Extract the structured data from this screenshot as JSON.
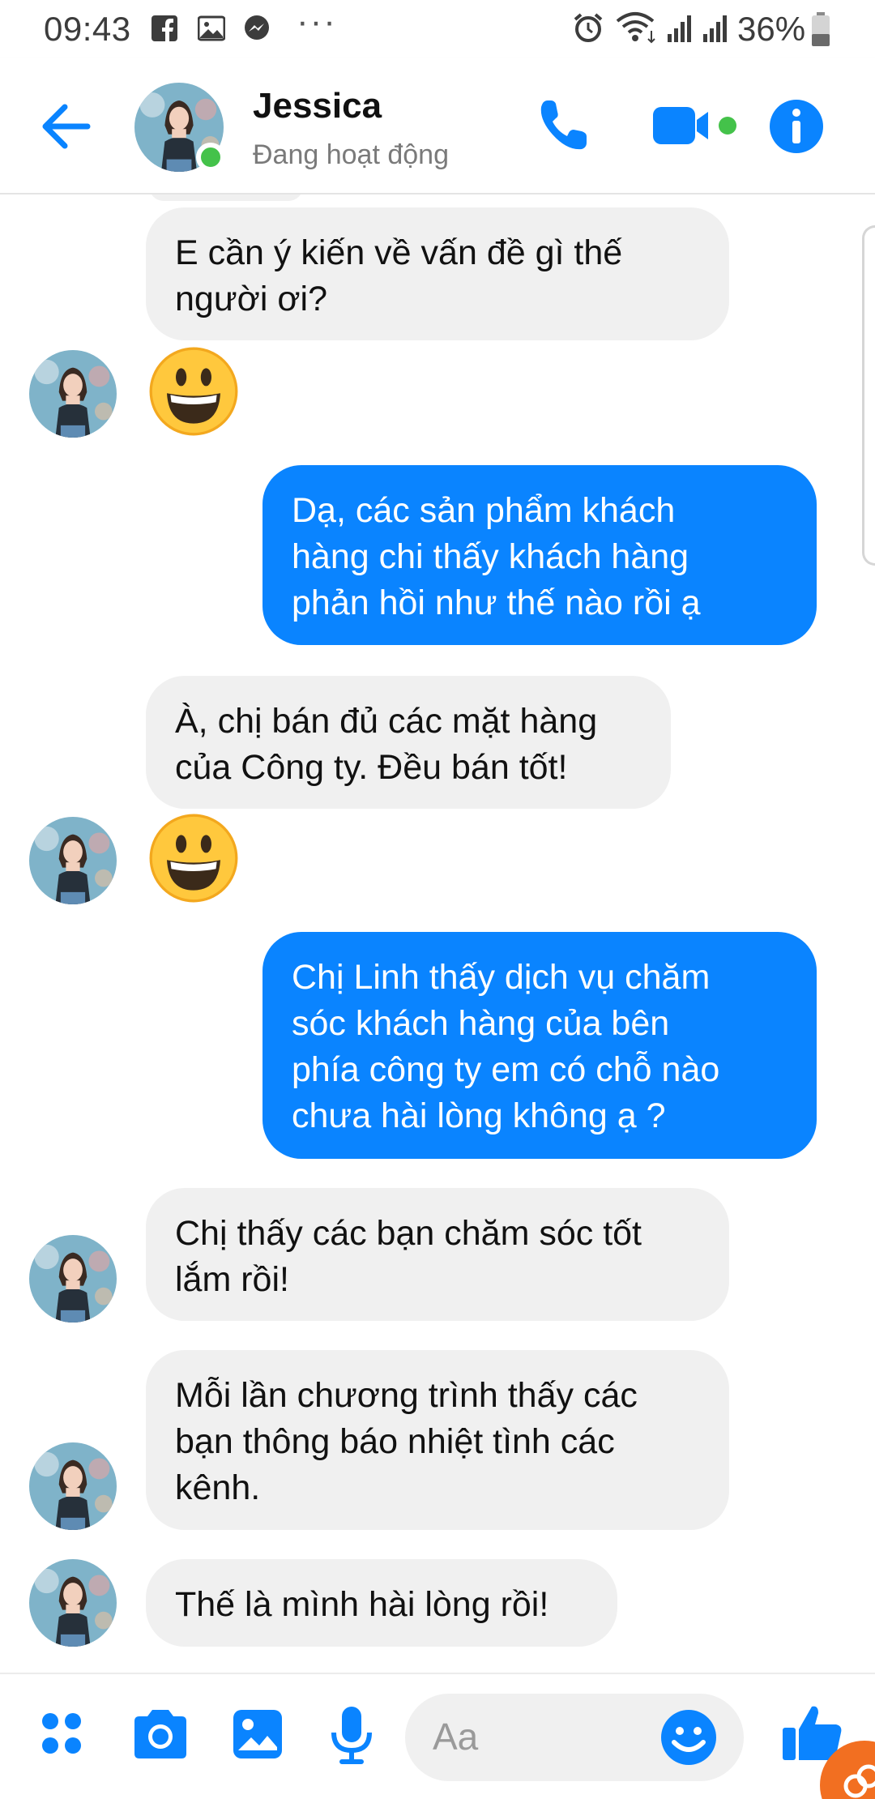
{
  "status_bar": {
    "time": "09:43",
    "battery": "36%"
  },
  "header": {
    "name": "Jessica",
    "status": "Đang hoạt động"
  },
  "messages": [
    {
      "from": "contact",
      "text": "E cần ý kiến về vấn đề gì thế\nngười ơi?"
    },
    {
      "from": "contact",
      "emoji": "grinning-face"
    },
    {
      "from": "me",
      "text": "Dạ, các sản phẩm khách\nhàng chi thấy khách hàng\nphản hồi như thế nào rồi ạ"
    },
    {
      "from": "contact",
      "text": "À, chị bán đủ các mặt hàng\ncủa Công ty. Đều bán tốt!"
    },
    {
      "from": "contact",
      "emoji": "grinning-face"
    },
    {
      "from": "me",
      "text": "Chị Linh thấy dịch vụ chăm\nsóc khách hàng của bên\nphía công ty em có chỗ nào\nchưa hài lòng không ạ ?"
    },
    {
      "from": "contact",
      "text": "Chị thấy các bạn chăm sóc tốt\nlắm rồi!"
    },
    {
      "from": "contact",
      "text": "Mỗi lần chương trình thấy các\nbạn thông báo nhiệt tình các\nkênh."
    },
    {
      "from": "contact",
      "text": "Thế là mình hài lòng rồi!"
    }
  ],
  "composer": {
    "placeholder": "Aa"
  },
  "colors": {
    "accent": "#0a84ff",
    "online": "#44c24a",
    "incoming_bubble": "#f0f0f0",
    "fab": "#f26f21"
  }
}
